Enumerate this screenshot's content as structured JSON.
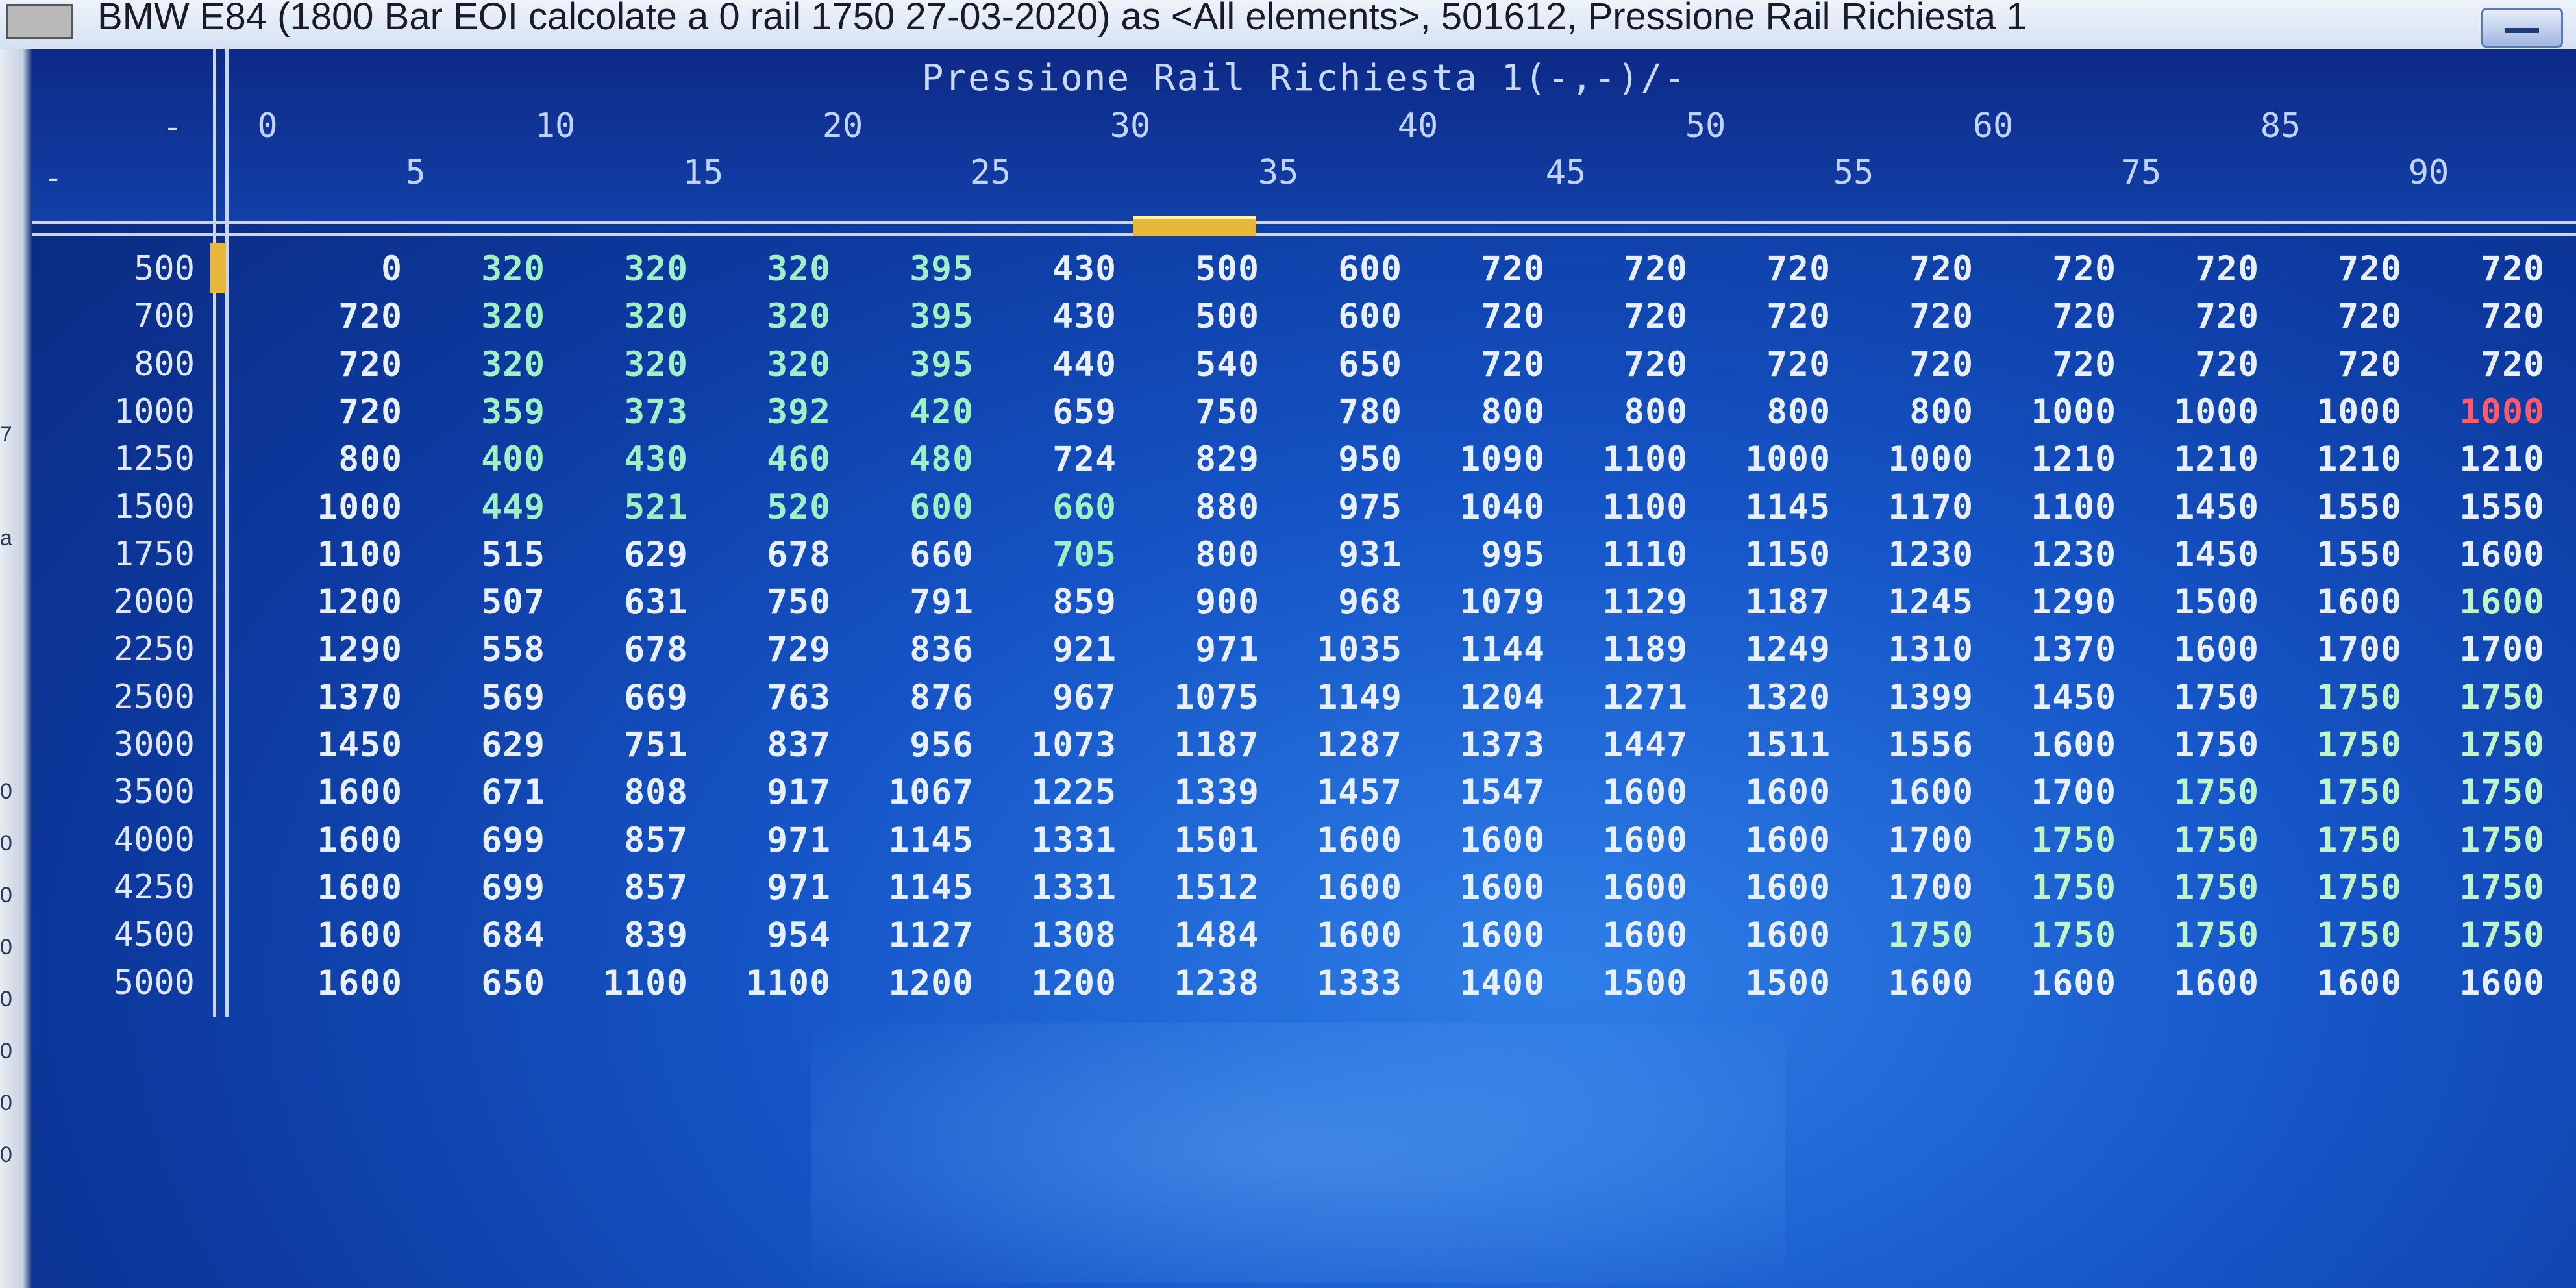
{
  "window": {
    "title": "BMW E84 (1800 Bar EOI calcolate a 0 rail 1750 27-03-2020) as <All elements>, 501612, Pressione Rail Richiesta 1",
    "minimize_icon": "minimize-icon"
  },
  "left_strip": {
    "marks": [
      "7",
      "a",
      "0",
      "0",
      "0",
      "0",
      "0",
      "0",
      "0",
      "0"
    ]
  },
  "map": {
    "title": "Pressione Rail Richiesta 1(-,-)/-",
    "corner_top": "-",
    "corner_left": "-",
    "col_headers_top": [
      "0",
      "10",
      "20",
      "30",
      "40",
      "50",
      "60",
      "85"
    ],
    "col_headers_bottom": [
      "5",
      "15",
      "25",
      "35",
      "45",
      "55",
      "75",
      "90"
    ],
    "row_headers": [
      "500",
      "700",
      "800",
      "1000",
      "1250",
      "1500",
      "1750",
      "2000",
      "2250",
      "2500",
      "3000",
      "3500",
      "4000",
      "4250",
      "4500",
      "5000"
    ],
    "rows": [
      [
        "0",
        "320",
        "320",
        "320",
        "395",
        "430",
        "500",
        "600",
        "720",
        "720",
        "720",
        "720",
        "720",
        "720",
        "720",
        "720"
      ],
      [
        "720",
        "320",
        "320",
        "320",
        "395",
        "430",
        "500",
        "600",
        "720",
        "720",
        "720",
        "720",
        "720",
        "720",
        "720",
        "720"
      ],
      [
        "720",
        "320",
        "320",
        "320",
        "395",
        "440",
        "540",
        "650",
        "720",
        "720",
        "720",
        "720",
        "720",
        "720",
        "720",
        "720"
      ],
      [
        "720",
        "359",
        "373",
        "392",
        "420",
        "659",
        "750",
        "780",
        "800",
        "800",
        "800",
        "800",
        "1000",
        "1000",
        "1000",
        "1000"
      ],
      [
        "800",
        "400",
        "430",
        "460",
        "480",
        "724",
        "829",
        "950",
        "1090",
        "1100",
        "1000",
        "1000",
        "1210",
        "1210",
        "1210",
        "1210"
      ],
      [
        "1000",
        "449",
        "521",
        "520",
        "600",
        "660",
        "880",
        "975",
        "1040",
        "1100",
        "1145",
        "1170",
        "1100",
        "1450",
        "1550",
        "1550"
      ],
      [
        "1100",
        "515",
        "629",
        "678",
        "660",
        "705",
        "800",
        "931",
        "995",
        "1110",
        "1150",
        "1230",
        "1230",
        "1450",
        "1550",
        "1600"
      ],
      [
        "1200",
        "507",
        "631",
        "750",
        "791",
        "859",
        "900",
        "968",
        "1079",
        "1129",
        "1187",
        "1245",
        "1290",
        "1500",
        "1600",
        "1600"
      ],
      [
        "1290",
        "558",
        "678",
        "729",
        "836",
        "921",
        "971",
        "1035",
        "1144",
        "1189",
        "1249",
        "1310",
        "1370",
        "1600",
        "1700",
        "1700"
      ],
      [
        "1370",
        "569",
        "669",
        "763",
        "876",
        "967",
        "1075",
        "1149",
        "1204",
        "1271",
        "1320",
        "1399",
        "1450",
        "1750",
        "1750",
        "1750"
      ],
      [
        "1450",
        "629",
        "751",
        "837",
        "956",
        "1073",
        "1187",
        "1287",
        "1373",
        "1447",
        "1511",
        "1556",
        "1600",
        "1750",
        "1750",
        "1750"
      ],
      [
        "1600",
        "671",
        "808",
        "917",
        "1067",
        "1225",
        "1339",
        "1457",
        "1547",
        "1600",
        "1600",
        "1600",
        "1700",
        "1750",
        "1750",
        "1750"
      ],
      [
        "1600",
        "699",
        "857",
        "971",
        "1145",
        "1331",
        "1501",
        "1600",
        "1600",
        "1600",
        "1600",
        "1700",
        "1750",
        "1750",
        "1750",
        "1750"
      ],
      [
        "1600",
        "699",
        "857",
        "971",
        "1145",
        "1331",
        "1512",
        "1600",
        "1600",
        "1600",
        "1600",
        "1700",
        "1750",
        "1750",
        "1750",
        "1750"
      ],
      [
        "1600",
        "684",
        "839",
        "954",
        "1127",
        "1308",
        "1484",
        "1600",
        "1600",
        "1600",
        "1600",
        "1750",
        "1750",
        "1750",
        "1750",
        "1750"
      ],
      [
        "1600",
        "650",
        "1100",
        "1100",
        "1200",
        "1200",
        "1238",
        "1333",
        "1400",
        "1500",
        "1500",
        "1600",
        "1600",
        "1600",
        "1600",
        "1600"
      ]
    ],
    "colors": {
      "default": "#e8efff",
      "green": "#9ff0c6",
      "red": "#ff5a6a",
      "light_green": "#bff5c8",
      "cursor": "#e6b83a"
    },
    "selected_column_header": "30",
    "selected_row_header": "500"
  }
}
